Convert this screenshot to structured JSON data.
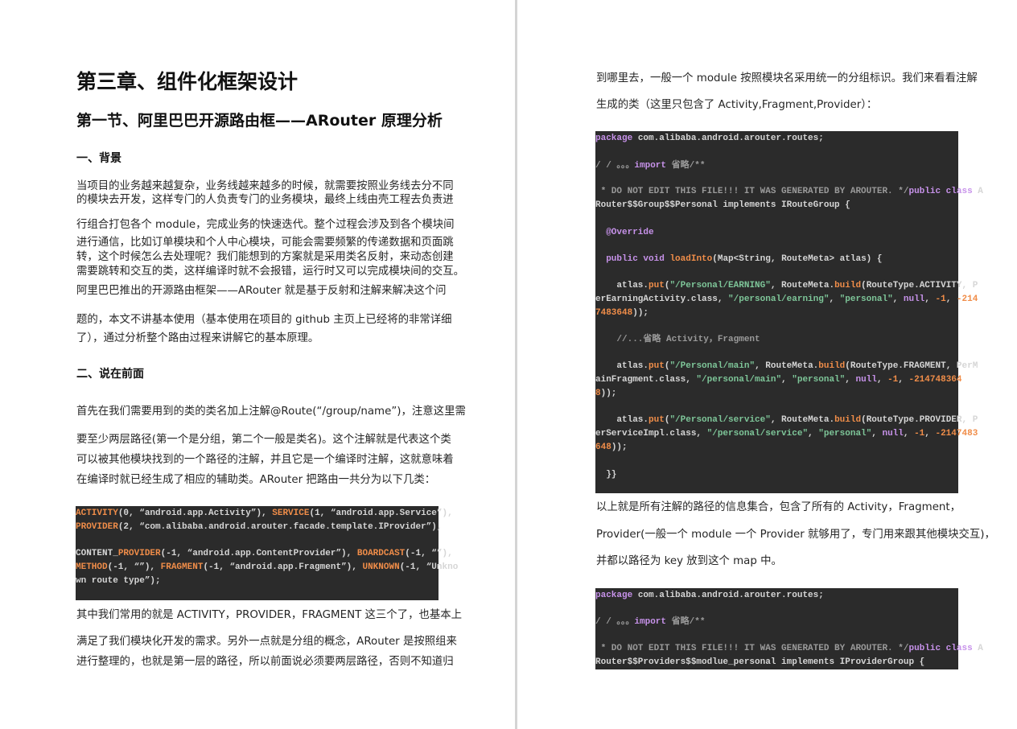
{
  "left_page": {
    "chapter_title": "第三章、组件化框架设计",
    "section_title": "第一节、阿里巴巴开源路由框——ARouter 原理分析",
    "heading_background": "一、背景",
    "para_background": [
      "当项目的业务越来越复杂，业务线越来越多的时候，就需要按照业务线去分不同",
      "的模块去开发，这样专门的人负责专门的业务模块，最终上线由壳工程去负责进",
      "行组合打包各个 module，完成业务的快速迭代。整个过程会涉及到各个模块间",
      "进行通信，比如订单模块和个人中心模块，可能会需要频繁的传递数据和页面跳",
      "转，这个时候怎么去处理呢？我们能想到的方案就是采用类名反射，来动态创建",
      "需要跳转和交互的类，这样编译时就不会报错，运行时又可以完成模块间的交互。",
      "阿里巴巴推出的开源路由框架——ARouter 就是基于反射和注解来解决这个问",
      "题的，本文不讲基本使用（基本使用在项目的 github 主页上已经将的非常详细",
      "了），通过分析整个路由过程来讲解它的基本原理。"
    ],
    "heading_preface": "二、说在前面",
    "para_preface": [
      "首先在我们需要用到的类的类名加上注解@Route(“/group/name”)，注意这里需",
      "要至少两层路径(第一个是分组，第二个一般是类名)。这个注解就是代表这个类",
      "可以被其他模块找到的一个路径的注解，并且它是一个编译时注解，这就意味着",
      "在编译时就已经生成了相应的辅助类。ARouter 把路由一共分为以下几类："
    ],
    "code_route_types": [
      [
        [
          "ACTIVITY",
          "o"
        ],
        [
          "(0, “android.app.Activity”), ",
          "d"
        ],
        [
          "SERVICE",
          "o"
        ],
        [
          "(1, “android.app.Service”),",
          "d"
        ]
      ],
      [
        [
          "PROVIDER",
          "o"
        ],
        [
          "(2, “com.alibaba.android.arouter.facade.template.IProvider”),",
          "d"
        ]
      ],
      [
        [
          "CONTENT_",
          "d"
        ],
        [
          "PROVIDER",
          "o"
        ],
        [
          "(-1, “android.app.ContentProvider”), ",
          "d"
        ],
        [
          "BOARDCAST",
          "o"
        ],
        [
          "(-1, “”),",
          "d"
        ]
      ],
      [
        [
          "METHOD",
          "o"
        ],
        [
          "(-1, “”), ",
          "d"
        ],
        [
          "FRAGMENT",
          "o"
        ],
        [
          "(-1, “android.app.Fragment”), ",
          "d"
        ],
        [
          "UNKNOWN",
          "o"
        ],
        [
          "(-1, “Unkno",
          "d"
        ]
      ],
      [
        [
          "wn route type”);",
          "d"
        ]
      ]
    ],
    "para_after": [
      "其中我们常用的就是 ACTIVITY，PROVIDER，FRAGMENT 这三个了，也基本上",
      "满足了我们模块化开发的需求。另外一点就是分组的概念，ARouter 是按照组来",
      "进行整理的，也就是第一层的路径，所以前面说必须要两层路径，否则不知道归"
    ]
  },
  "right_page": {
    "para_top": [
      "到哪里去，一般一个 module 按照模块名采用统一的分组标识。我们来看看注解",
      "生成的类（这里只包含了 Activity,Fragment,Provider）："
    ],
    "code_group": [
      [
        [
          "package",
          "k"
        ],
        [
          " com.alibaba.android.arouter.routes;",
          "d"
        ]
      ],
      [
        [
          "/ / 。。。",
          "c"
        ],
        [
          "import",
          "k"
        ],
        [
          " 省略/**",
          "c"
        ]
      ],
      [
        [
          " * DO NOT EDIT THIS FILE!!! IT WAS GENERATED BY AROUTER. */",
          "c"
        ],
        [
          "public class",
          "k"
        ],
        [
          " A",
          "d"
        ]
      ],
      [
        [
          "Router$$Group$$Personal implements IRouteGroup {",
          "d"
        ]
      ],
      [
        [
          "  ",
          "d"
        ],
        [
          "@Override",
          "k"
        ]
      ],
      [
        [
          "  ",
          "d"
        ],
        [
          "public void",
          "k"
        ],
        [
          " ",
          "d"
        ],
        [
          "loadInto",
          "o"
        ],
        [
          "(Map<String, RouteMeta> atlas) {",
          "d"
        ]
      ],
      [
        [
          "    atlas.",
          "d"
        ],
        [
          "put",
          "o"
        ],
        [
          "(",
          "d"
        ],
        [
          "\"/Personal/EARNING\"",
          "s"
        ],
        [
          ", RouteMeta.",
          "d"
        ],
        [
          "build",
          "o"
        ],
        [
          "(RouteType.ACTIVITY, P",
          "d"
        ]
      ],
      [
        [
          "erEarningActivity.class, ",
          "d"
        ],
        [
          "\"/personal/earning\"",
          "s"
        ],
        [
          ", ",
          "d"
        ],
        [
          "\"personal\"",
          "s"
        ],
        [
          ", ",
          "d"
        ],
        [
          "null",
          "k"
        ],
        [
          ", ",
          "d"
        ],
        [
          "-1",
          "o"
        ],
        [
          ", ",
          "d"
        ],
        [
          "-214",
          "o"
        ]
      ],
      [
        [
          "7483648",
          "o"
        ],
        [
          "));",
          "d"
        ]
      ],
      [
        [
          "    //...省略 Activity，Fragment",
          "c"
        ]
      ],
      [
        [
          "    atlas.",
          "d"
        ],
        [
          "put",
          "o"
        ],
        [
          "(",
          "d"
        ],
        [
          "\"/Personal/main\"",
          "s"
        ],
        [
          ", RouteMeta.",
          "d"
        ],
        [
          "build",
          "o"
        ],
        [
          "(RouteType.FRAGMENT, PerM",
          "d"
        ]
      ],
      [
        [
          "ainFragment.class, ",
          "d"
        ],
        [
          "\"/personal/main\"",
          "s"
        ],
        [
          ", ",
          "d"
        ],
        [
          "\"personal\"",
          "s"
        ],
        [
          ", ",
          "d"
        ],
        [
          "null",
          "k"
        ],
        [
          ", ",
          "d"
        ],
        [
          "-1",
          "o"
        ],
        [
          ", ",
          "d"
        ],
        [
          "-214748364",
          "o"
        ]
      ],
      [
        [
          "8",
          "o"
        ],
        [
          "));",
          "d"
        ]
      ],
      [
        [
          "    atlas.",
          "d"
        ],
        [
          "put",
          "o"
        ],
        [
          "(",
          "d"
        ],
        [
          "\"/Personal/service\"",
          "s"
        ],
        [
          ", RouteMeta.",
          "d"
        ],
        [
          "build",
          "o"
        ],
        [
          "(RouteType.PROVIDER, P",
          "d"
        ]
      ],
      [
        [
          "erServiceImpl.class, ",
          "d"
        ],
        [
          "\"/personal/service\"",
          "s"
        ],
        [
          ", ",
          "d"
        ],
        [
          "\"personal\"",
          "s"
        ],
        [
          ", ",
          "d"
        ],
        [
          "null",
          "k"
        ],
        [
          ", ",
          "d"
        ],
        [
          "-1",
          "o"
        ],
        [
          ", ",
          "d"
        ],
        [
          "-2147483",
          "o"
        ]
      ],
      [
        [
          "648",
          "o"
        ],
        [
          "));",
          "d"
        ]
      ],
      [
        [
          "  }}",
          "d"
        ]
      ]
    ],
    "para_middle": [
      "以上就是所有注解的路径的信息集合，包含了所有的 Activity，Fragment，",
      "Provider(一般一个 module 一个 Provider 就够用了，专门用来跟其他模块交互)，",
      "并都以路径为 key 放到这个 map 中。"
    ],
    "code_providers": [
      [
        [
          "package",
          "k"
        ],
        [
          " com.alibaba.android.arouter.routes;",
          "d"
        ]
      ],
      [
        [
          "/ / 。。。",
          "c"
        ],
        [
          "import",
          "k"
        ],
        [
          " 省略/**",
          "c"
        ]
      ],
      [
        [
          " * DO NOT EDIT THIS FILE!!! IT WAS GENERATED BY AROUTER. */",
          "c"
        ],
        [
          "public class",
          "k"
        ],
        [
          " A",
          "d"
        ]
      ],
      [
        [
          "Router$$Providers$$modlue_personal implements IProviderGroup {",
          "d"
        ]
      ]
    ]
  },
  "colors": {
    "code_bg": "#2b2b2b",
    "keyword": "#c792ea",
    "accent": "#f08d49",
    "string": "#7ec699",
    "comment": "#9a9a9a"
  }
}
